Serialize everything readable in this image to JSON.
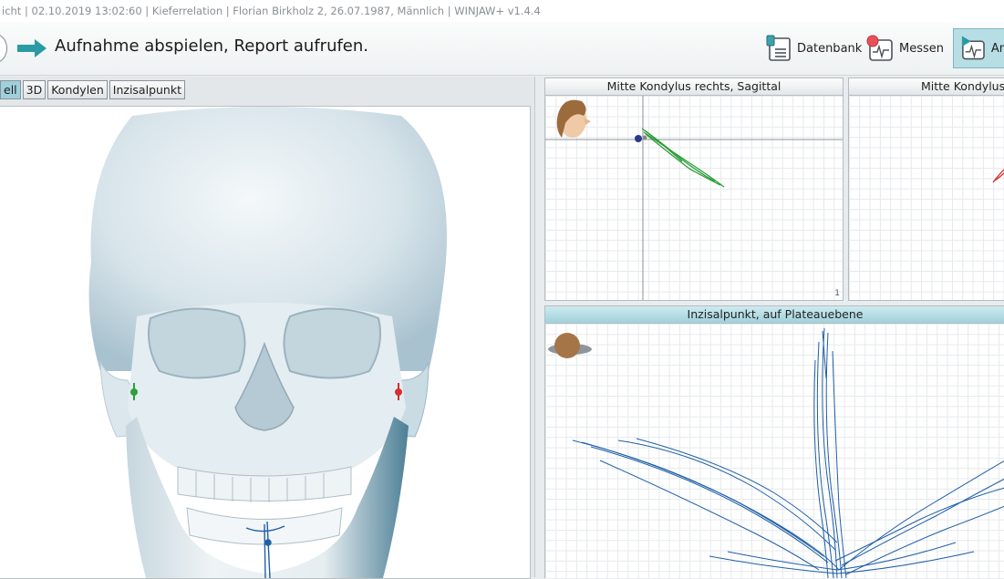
{
  "window": {
    "title": "icht | 02.10.2019 13:02:60 | Kieferrelation | Florian Birkholz 2, 26.07.1987, Männlich | WINJAW+ v1.4.4"
  },
  "toolbar": {
    "instruction": "Aufnahme abspielen, Report aufrufen.",
    "buttons": [
      {
        "label": "Datenbank",
        "icon": "database-icon"
      },
      {
        "label": "Messen",
        "icon": "measure-icon"
      },
      {
        "label": "An",
        "icon": "analysis-icon",
        "active": true
      }
    ]
  },
  "view_tabs": [
    {
      "label": "ell",
      "selected": true
    },
    {
      "label": "3D",
      "selected": false
    },
    {
      "label": "Kondylen",
      "selected": false
    },
    {
      "label": "Inzisalpunkt",
      "selected": false
    }
  ],
  "plots": {
    "sagittal_right": {
      "title": "Mitte Kondylus rechts, Sagittal",
      "page_number": "1"
    },
    "sagittal_left": {
      "title": "Mitte Kondylus"
    },
    "incisal": {
      "title": "Inzisalpunkt, auf Plateauebene"
    }
  },
  "colors": {
    "accent": "#2a9aa5",
    "active_header": "#9fd2dc",
    "trace_green": "#2e9e3a",
    "trace_red": "#d62f2f",
    "trace_blue": "#1f5fa8"
  }
}
